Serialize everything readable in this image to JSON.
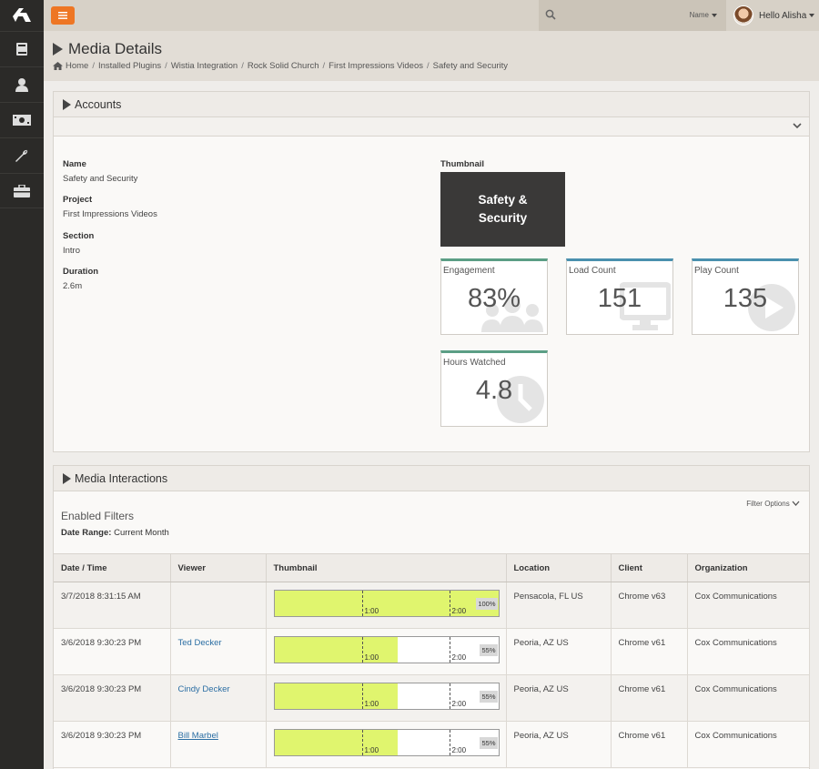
{
  "topbar": {
    "search_scope": "Name",
    "greeting": "Hello Alisha"
  },
  "page": {
    "title": "Media Details",
    "breadcrumbs": [
      "Home",
      "Installed Plugins",
      "Wistia Integration",
      "Rock Solid Church",
      "First Impressions Videos",
      "Safety and Security"
    ]
  },
  "accounts": {
    "title": "Accounts",
    "fields": [
      {
        "label": "Name",
        "value": "Safety and Security"
      },
      {
        "label": "Project",
        "value": "First Impressions Videos"
      },
      {
        "label": "Section",
        "value": "Intro"
      },
      {
        "label": "Duration",
        "value": "2.6m"
      }
    ],
    "thumbnail_label": "Thumbnail",
    "thumbnail_line1": "Safety &",
    "thumbnail_line2": "Security",
    "kpis": [
      {
        "label": "Engagement",
        "value": "83%",
        "color": "#5b9e85",
        "icon": "users-icon"
      },
      {
        "label": "Load Count",
        "value": "151",
        "color": "#4a90ae",
        "icon": "desktop-icon"
      },
      {
        "label": "Play Count",
        "value": "135",
        "color": "#4a90ae",
        "icon": "play-circle-icon"
      },
      {
        "label": "Hours Watched",
        "value": "4.8",
        "color": "#5b9e85",
        "icon": "clock-icon"
      }
    ]
  },
  "interactions": {
    "title": "Media Interactions",
    "filters_title": "Enabled Filters",
    "date_range_label": "Date Range:",
    "date_range_value": "Current Month",
    "filter_options": "Filter Options",
    "columns": [
      "Date / Time",
      "Viewer",
      "Thumbnail",
      "Location",
      "Client",
      "Organization"
    ],
    "rows": [
      {
        "datetime": "3/7/2018 8:31:15 AM",
        "viewer": "",
        "watched": 1.0,
        "percent": "100%",
        "location": "Pensacola, FL US",
        "client": "Chrome v63",
        "organization": "Cox Communications"
      },
      {
        "datetime": "3/6/2018 9:30:23 PM",
        "viewer": "Ted Decker",
        "watched": 0.55,
        "percent": "55%",
        "location": "Peoria, AZ US",
        "client": "Chrome v61",
        "organization": "Cox Communications"
      },
      {
        "datetime": "3/6/2018 9:30:23 PM",
        "viewer": "Cindy Decker",
        "watched": 0.55,
        "percent": "55%",
        "location": "Peoria, AZ US",
        "client": "Chrome v61",
        "organization": "Cox Communications"
      },
      {
        "datetime": "3/6/2018 9:30:23 PM",
        "viewer": "Bill Marbel",
        "watched": 0.55,
        "percent": "55%",
        "location": "Peoria, AZ US",
        "client": "Chrome v61",
        "organization": "Cox Communications"
      }
    ],
    "tick_labels": [
      "1:00",
      "2:00"
    ]
  }
}
